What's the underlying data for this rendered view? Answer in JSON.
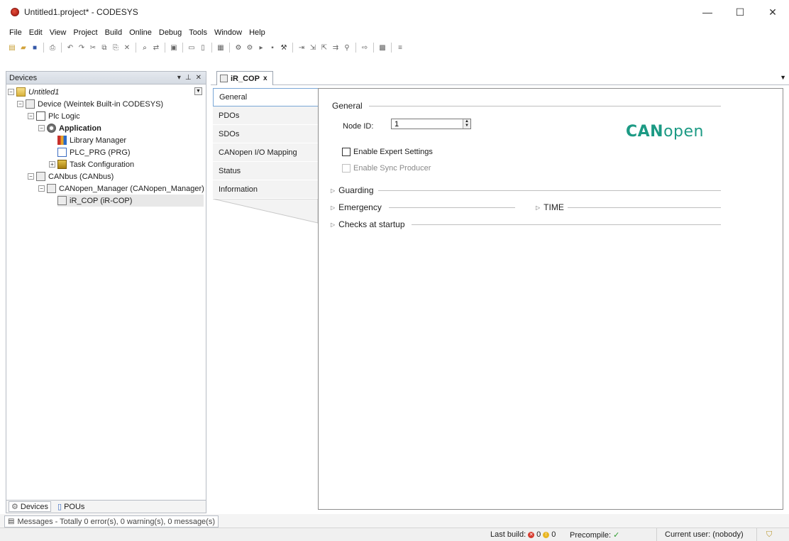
{
  "window": {
    "title": "Untitled1.project* - CODESYS",
    "minimize": "—",
    "maximize": "☐",
    "close": "✕"
  },
  "menu": [
    "File",
    "Edit",
    "View",
    "Project",
    "Build",
    "Online",
    "Debug",
    "Tools",
    "Window",
    "Help"
  ],
  "devices_panel": {
    "title": "Devices",
    "tree": [
      {
        "label": "Untitled1",
        "level": 0,
        "expander": "−",
        "icon": "project-icon"
      },
      {
        "label": "Device (Weintek Built-in CODESYS)",
        "level": 1,
        "expander": "−",
        "icon": "device-icon"
      },
      {
        "label": "Plc Logic",
        "level": 2,
        "expander": "−",
        "icon": "plc-logic-icon"
      },
      {
        "label": "Application",
        "level": 3,
        "expander": "−",
        "icon": "application-icon"
      },
      {
        "label": "Library Manager",
        "level": 4,
        "expander": "",
        "icon": "library-icon"
      },
      {
        "label": "PLC_PRG (PRG)",
        "level": 4,
        "expander": "",
        "icon": "program-icon"
      },
      {
        "label": "Task Configuration",
        "level": 4,
        "expander": "+",
        "icon": "task-icon"
      },
      {
        "label": "CANbus (CANbus)",
        "level": 1,
        "expander": "−",
        "icon": "canbus-icon"
      },
      {
        "label": "CANopen_Manager (CANopen_Manager)",
        "level": 2,
        "expander": "−",
        "icon": "canopen-manager-icon"
      },
      {
        "label": "iR_COP (iR-COP)",
        "level": 3,
        "expander": "",
        "icon": "ir-cop-icon"
      }
    ],
    "bottom_tabs": [
      "Devices",
      "POUs"
    ]
  },
  "editor": {
    "tab_label": "iR_COP",
    "tab_close": "x",
    "side_tabs": [
      "General",
      "PDOs",
      "SDOs",
      "CANopen I/O Mapping",
      "Status",
      "Information"
    ],
    "general": {
      "section_title": "General",
      "node_id_label": "Node ID:",
      "node_id_value": "1",
      "enable_expert": "Enable Expert Settings",
      "enable_sync": "Enable Sync Producer",
      "logo_can": "CAN",
      "logo_open": "open"
    },
    "sections": {
      "guarding": "Guarding",
      "emergency": "Emergency",
      "time": "TIME",
      "checks": "Checks at startup"
    }
  },
  "messages": {
    "label": "Messages - Totally 0 error(s), 0 warning(s), 0 message(s)"
  },
  "status": {
    "last_build": "Last build:",
    "errors": "0",
    "warnings": "0",
    "precompile": "Precompile:",
    "precompile_ok": "✓",
    "current_user": "Current user: (nobody)"
  }
}
